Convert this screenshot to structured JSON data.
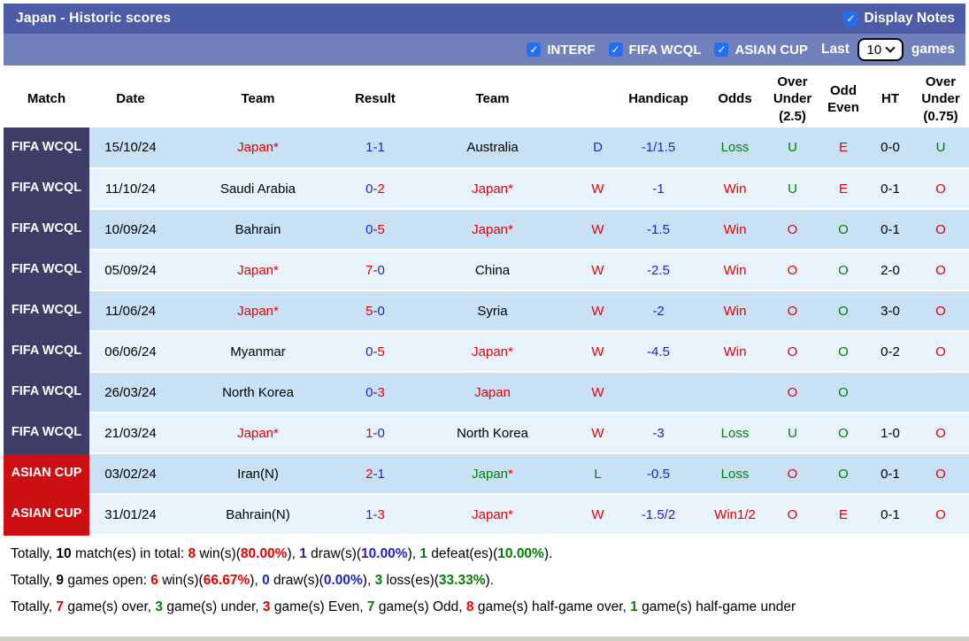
{
  "title_bar": {
    "title": "Japan - Historic scores",
    "display_notes": {
      "label": "Display Notes",
      "checked": true
    }
  },
  "filter_bar": {
    "options": [
      {
        "label": "INTERF",
        "checked": true
      },
      {
        "label": "FIFA WCQL",
        "checked": true
      },
      {
        "label": "ASIAN CUP",
        "checked": true
      }
    ],
    "last_label": "Last",
    "selected_games": "10",
    "games_label": "games"
  },
  "colors": {
    "topbar": "#4d5ca6",
    "filterbar": "#7181bb",
    "checkbox": "#2270ee",
    "league_fifa": "#3d3d68",
    "league_asian": "#cc0f12",
    "row_odd": "#c9e1f5",
    "row_even": "#e9f3fc",
    "red": "#e60000",
    "blue": "#2222cc",
    "green": "#008000",
    "black": "#000000"
  },
  "table": {
    "headers": [
      "Match",
      "Date",
      "Team",
      "Result",
      "Team",
      "",
      "Handicap",
      "Odds",
      "Over Under (2.5)",
      "Odd Even",
      "HT",
      "Over Under (0.75)"
    ],
    "rows": [
      {
        "league": "FIFA WCQL",
        "league_color": "league_fifa",
        "date": "15/10/24",
        "team1": [
          {
            "t": "Japan*",
            "c": "red"
          }
        ],
        "result": [
          {
            "t": "1-1",
            "c": "blue"
          }
        ],
        "team2": [
          {
            "t": "Australia",
            "c": "black"
          }
        ],
        "wdl": {
          "t": "D",
          "c": "blue"
        },
        "handicap": {
          "t": "-1/1.5",
          "c": "blue"
        },
        "odds": {
          "t": "Loss",
          "c": "green"
        },
        "ou25": {
          "t": "U",
          "c": "green"
        },
        "odd_even": {
          "t": "E",
          "c": "red"
        },
        "ht": {
          "t": "0-0",
          "c": "black"
        },
        "ou075": {
          "t": "U",
          "c": "green"
        }
      },
      {
        "league": "FIFA WCQL",
        "league_color": "league_fifa",
        "date": "11/10/24",
        "team1": [
          {
            "t": "Saudi Arabia",
            "c": "black"
          }
        ],
        "result": [
          {
            "t": "0-",
            "c": "blue"
          },
          {
            "t": "2",
            "c": "red"
          }
        ],
        "team2": [
          {
            "t": "Japan*",
            "c": "red"
          }
        ],
        "wdl": {
          "t": "W",
          "c": "red"
        },
        "handicap": {
          "t": "-1",
          "c": "blue"
        },
        "odds": {
          "t": "Win",
          "c": "red"
        },
        "ou25": {
          "t": "U",
          "c": "green"
        },
        "odd_even": {
          "t": "E",
          "c": "red"
        },
        "ht": {
          "t": "0-1",
          "c": "black"
        },
        "ou075": {
          "t": "O",
          "c": "red"
        }
      },
      {
        "league": "FIFA WCQL",
        "league_color": "league_fifa",
        "date": "10/09/24",
        "team1": [
          {
            "t": "Bahrain",
            "c": "black"
          }
        ],
        "result": [
          {
            "t": "0-",
            "c": "blue"
          },
          {
            "t": "5",
            "c": "red"
          }
        ],
        "team2": [
          {
            "t": "Japan*",
            "c": "red"
          }
        ],
        "wdl": {
          "t": "W",
          "c": "red"
        },
        "handicap": {
          "t": "-1.5",
          "c": "blue"
        },
        "odds": {
          "t": "Win",
          "c": "red"
        },
        "ou25": {
          "t": "O",
          "c": "red"
        },
        "odd_even": {
          "t": "O",
          "c": "green"
        },
        "ht": {
          "t": "0-1",
          "c": "black"
        },
        "ou075": {
          "t": "O",
          "c": "red"
        }
      },
      {
        "league": "FIFA WCQL",
        "league_color": "league_fifa",
        "date": "05/09/24",
        "team1": [
          {
            "t": "Japan*",
            "c": "red"
          }
        ],
        "result": [
          {
            "t": "7",
            "c": "red"
          },
          {
            "t": "-0",
            "c": "blue"
          }
        ],
        "team2": [
          {
            "t": "China",
            "c": "black"
          }
        ],
        "wdl": {
          "t": "W",
          "c": "red"
        },
        "handicap": {
          "t": "-2.5",
          "c": "blue"
        },
        "odds": {
          "t": "Win",
          "c": "red"
        },
        "ou25": {
          "t": "O",
          "c": "red"
        },
        "odd_even": {
          "t": "O",
          "c": "green"
        },
        "ht": {
          "t": "2-0",
          "c": "black"
        },
        "ou075": {
          "t": "O",
          "c": "red"
        }
      },
      {
        "league": "FIFA WCQL",
        "league_color": "league_fifa",
        "date": "11/06/24",
        "team1": [
          {
            "t": "Japan*",
            "c": "red"
          }
        ],
        "result": [
          {
            "t": "5",
            "c": "red"
          },
          {
            "t": "-0",
            "c": "blue"
          }
        ],
        "team2": [
          {
            "t": "Syria",
            "c": "black"
          }
        ],
        "wdl": {
          "t": "W",
          "c": "red"
        },
        "handicap": {
          "t": "-2",
          "c": "blue"
        },
        "odds": {
          "t": "Win",
          "c": "red"
        },
        "ou25": {
          "t": "O",
          "c": "red"
        },
        "odd_even": {
          "t": "O",
          "c": "green"
        },
        "ht": {
          "t": "3-0",
          "c": "black"
        },
        "ou075": {
          "t": "O",
          "c": "red"
        }
      },
      {
        "league": "FIFA WCQL",
        "league_color": "league_fifa",
        "date": "06/06/24",
        "team1": [
          {
            "t": "Myanmar",
            "c": "black"
          }
        ],
        "result": [
          {
            "t": "0-",
            "c": "blue"
          },
          {
            "t": "5",
            "c": "red"
          }
        ],
        "team2": [
          {
            "t": "Japan*",
            "c": "red"
          }
        ],
        "wdl": {
          "t": "W",
          "c": "red"
        },
        "handicap": {
          "t": "-4.5",
          "c": "blue"
        },
        "odds": {
          "t": "Win",
          "c": "red"
        },
        "ou25": {
          "t": "O",
          "c": "red"
        },
        "odd_even": {
          "t": "O",
          "c": "green"
        },
        "ht": {
          "t": "0-2",
          "c": "black"
        },
        "ou075": {
          "t": "O",
          "c": "red"
        }
      },
      {
        "league": "FIFA WCQL",
        "league_color": "league_fifa",
        "date": "26/03/24",
        "team1": [
          {
            "t": "North Korea",
            "c": "black"
          }
        ],
        "result": [
          {
            "t": "0-",
            "c": "blue"
          },
          {
            "t": "3",
            "c": "red"
          }
        ],
        "team2": [
          {
            "t": "Japan",
            "c": "red"
          }
        ],
        "wdl": {
          "t": "W",
          "c": "red"
        },
        "handicap": {
          "t": "",
          "c": "blue"
        },
        "odds": {
          "t": "",
          "c": "red"
        },
        "ou25": {
          "t": "O",
          "c": "red"
        },
        "odd_even": {
          "t": "O",
          "c": "green"
        },
        "ht": {
          "t": "",
          "c": "black"
        },
        "ou075": {
          "t": "",
          "c": "red"
        }
      },
      {
        "league": "FIFA WCQL",
        "league_color": "league_fifa",
        "date": "21/03/24",
        "team1": [
          {
            "t": "Japan*",
            "c": "red"
          }
        ],
        "result": [
          {
            "t": "1",
            "c": "red"
          },
          {
            "t": "-0",
            "c": "blue"
          }
        ],
        "team2": [
          {
            "t": "North Korea",
            "c": "black"
          }
        ],
        "wdl": {
          "t": "W",
          "c": "red"
        },
        "handicap": {
          "t": "-3",
          "c": "blue"
        },
        "odds": {
          "t": "Loss",
          "c": "green"
        },
        "ou25": {
          "t": "U",
          "c": "green"
        },
        "odd_even": {
          "t": "O",
          "c": "green"
        },
        "ht": {
          "t": "1-0",
          "c": "black"
        },
        "ou075": {
          "t": "O",
          "c": "red"
        }
      },
      {
        "league": "ASIAN CUP",
        "league_color": "league_asian",
        "date": "03/02/24",
        "team1": [
          {
            "t": "Iran(N)",
            "c": "black"
          }
        ],
        "result": [
          {
            "t": "2",
            "c": "red"
          },
          {
            "t": "-1",
            "c": "blue"
          }
        ],
        "team2": [
          {
            "t": "Japan",
            "c": "green"
          },
          {
            "t": "*",
            "c": "red"
          }
        ],
        "wdl": {
          "t": "L",
          "c": "green"
        },
        "handicap": {
          "t": "-0.5",
          "c": "blue"
        },
        "odds": {
          "t": "Loss",
          "c": "green"
        },
        "ou25": {
          "t": "O",
          "c": "red"
        },
        "odd_even": {
          "t": "O",
          "c": "green"
        },
        "ht": {
          "t": "0-1",
          "c": "black"
        },
        "ou075": {
          "t": "O",
          "c": "red"
        }
      },
      {
        "league": "ASIAN CUP",
        "league_color": "league_asian",
        "date": "31/01/24",
        "team1": [
          {
            "t": "Bahrain(N)",
            "c": "black"
          }
        ],
        "result": [
          {
            "t": "1-",
            "c": "blue"
          },
          {
            "t": "3",
            "c": "red"
          }
        ],
        "team2": [
          {
            "t": "Japan*",
            "c": "red"
          }
        ],
        "wdl": {
          "t": "W",
          "c": "red"
        },
        "handicap": {
          "t": "-1.5/2",
          "c": "blue"
        },
        "odds": {
          "t": "Win1/2",
          "c": "red"
        },
        "ou25": {
          "t": "O",
          "c": "red"
        },
        "odd_even": {
          "t": "E",
          "c": "red"
        },
        "ht": {
          "t": "0-1",
          "c": "black"
        },
        "ou075": {
          "t": "O",
          "c": "red"
        }
      }
    ]
  },
  "footer": {
    "lines": [
      [
        {
          "t": "Totally, "
        },
        {
          "t": "10",
          "b": 1
        },
        {
          "t": " match(es) in total: "
        },
        {
          "t": "8",
          "c": "red",
          "b": 1
        },
        {
          "t": " win(s)("
        },
        {
          "t": "80.00%",
          "c": "red",
          "b": 1
        },
        {
          "t": "), "
        },
        {
          "t": "1",
          "c": "blue",
          "b": 1
        },
        {
          "t": " draw(s)("
        },
        {
          "t": "10.00%",
          "c": "blue",
          "b": 1
        },
        {
          "t": "), "
        },
        {
          "t": "1",
          "c": "green",
          "b": 1
        },
        {
          "t": " defeat(es)("
        },
        {
          "t": "10.00%",
          "c": "green",
          "b": 1
        },
        {
          "t": ")."
        }
      ],
      [
        {
          "t": "Totally, "
        },
        {
          "t": "9",
          "b": 1
        },
        {
          "t": " games open: "
        },
        {
          "t": "6",
          "c": "red",
          "b": 1
        },
        {
          "t": " win(s)("
        },
        {
          "t": "66.67%",
          "c": "red",
          "b": 1
        },
        {
          "t": "), "
        },
        {
          "t": "0",
          "c": "blue",
          "b": 1
        },
        {
          "t": " draw(s)("
        },
        {
          "t": "0.00%",
          "c": "blue",
          "b": 1
        },
        {
          "t": "), "
        },
        {
          "t": "3",
          "c": "green",
          "b": 1
        },
        {
          "t": " loss(es)("
        },
        {
          "t": "33.33%",
          "c": "green",
          "b": 1
        },
        {
          "t": ")."
        }
      ],
      [
        {
          "t": "Totally, "
        },
        {
          "t": "7",
          "c": "red",
          "b": 1
        },
        {
          "t": " game(s) over, "
        },
        {
          "t": "3",
          "c": "green",
          "b": 1
        },
        {
          "t": " game(s) under, "
        },
        {
          "t": "3",
          "c": "red",
          "b": 1
        },
        {
          "t": " game(s) Even, "
        },
        {
          "t": "7",
          "c": "green",
          "b": 1
        },
        {
          "t": " game(s) Odd, "
        },
        {
          "t": "8",
          "c": "red",
          "b": 1
        },
        {
          "t": " game(s) half-game over, "
        },
        {
          "t": "1",
          "c": "green",
          "b": 1
        },
        {
          "t": " game(s) half-game under"
        }
      ]
    ]
  }
}
